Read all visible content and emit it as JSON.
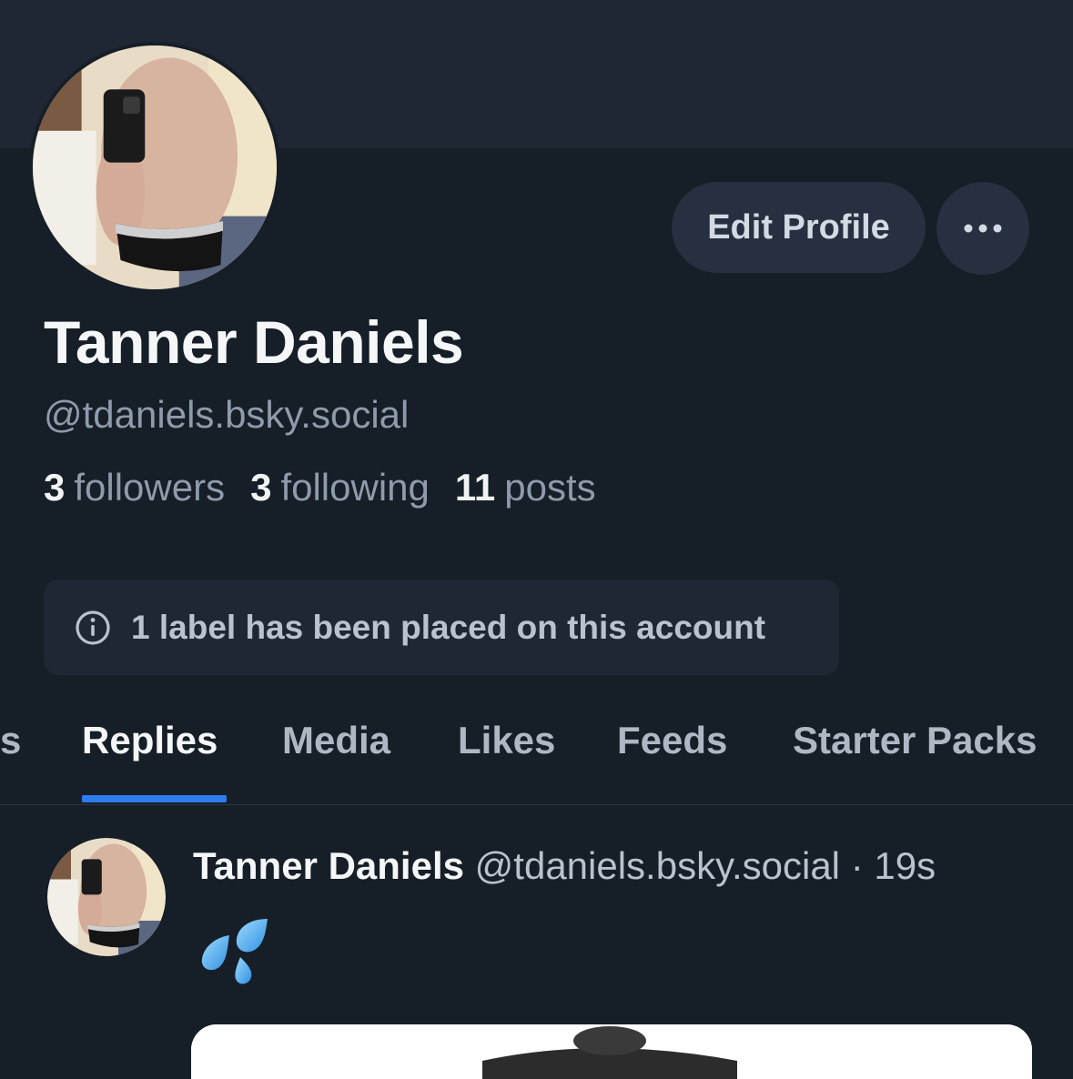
{
  "profile": {
    "display_name": "Tanner Daniels",
    "handle": "@tdaniels.bsky.social",
    "edit_profile_label": "Edit Profile",
    "more_label": "•••",
    "stats": {
      "followers_count": "3",
      "followers_label": "followers",
      "following_count": "3",
      "following_label": "following",
      "posts_count": "11",
      "posts_label": "posts"
    },
    "label_notice": "1 label has been placed on this account"
  },
  "tabs": [
    {
      "label": "Posts",
      "visible_text": "ts",
      "active": false
    },
    {
      "label": "Replies",
      "visible_text": "Replies",
      "active": true
    },
    {
      "label": "Media",
      "visible_text": "Media",
      "active": false
    },
    {
      "label": "Likes",
      "visible_text": "Likes",
      "active": false
    },
    {
      "label": "Feeds",
      "visible_text": "Feeds",
      "active": false
    },
    {
      "label": "Starter Packs",
      "visible_text": "Starter Packs",
      "active": false
    }
  ],
  "post": {
    "author": "Tanner Daniels",
    "handle": "@tdaniels.bsky.social",
    "separator": "·",
    "time": "19s",
    "content_emoji": "💦"
  },
  "colors": {
    "background": "#161e27",
    "banner": "#1f2735",
    "button_bg": "#263040",
    "accent": "#2f7bf0",
    "text_primary": "#f4f6f8",
    "text_secondary": "#8e9bab"
  },
  "icons": {
    "more": "ellipsis-icon",
    "info": "info-circle-icon",
    "emoji": "sweat-droplets-icon"
  }
}
